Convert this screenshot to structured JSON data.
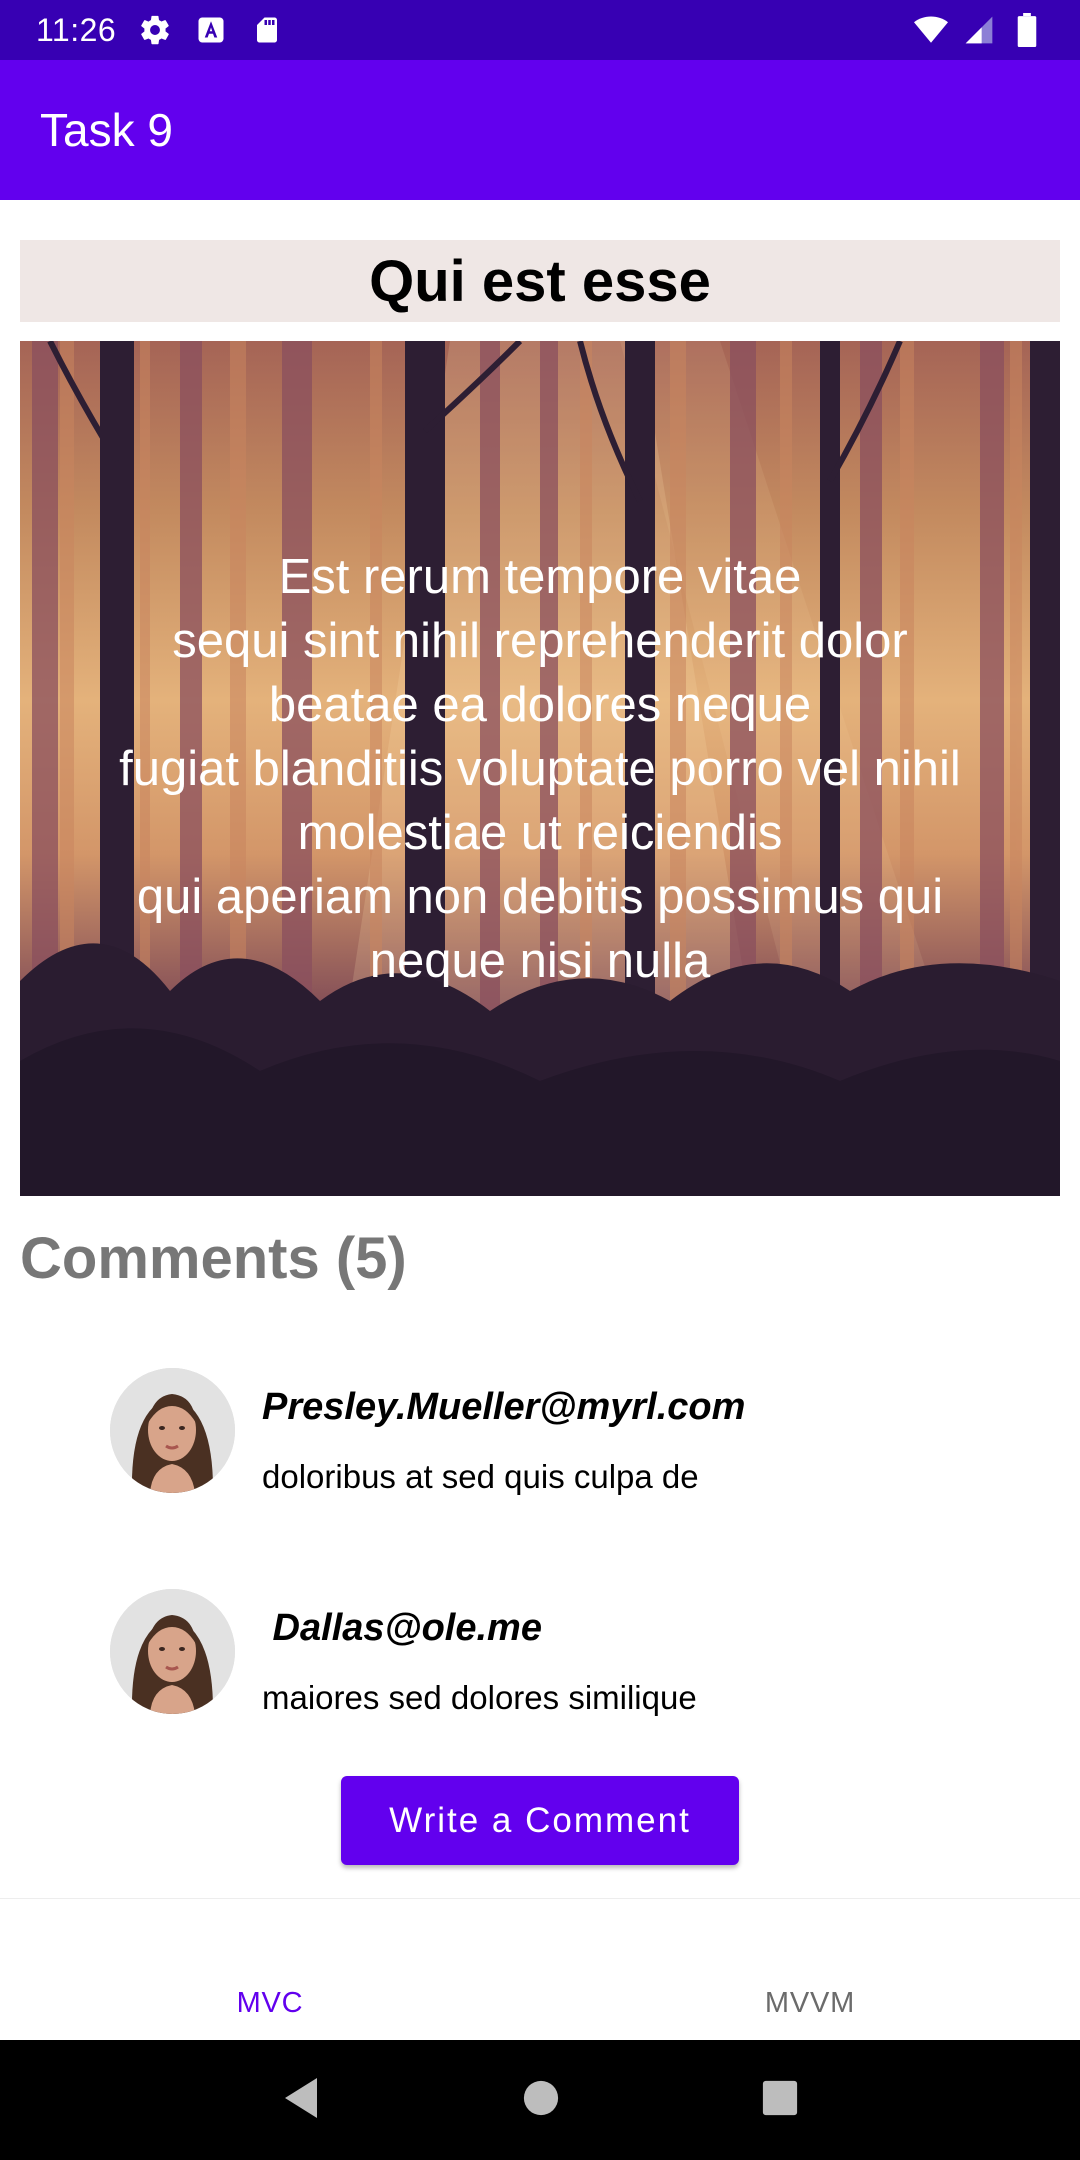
{
  "status_bar": {
    "time": "11:26",
    "left_icons": [
      "gear-icon",
      "font-a-icon",
      "sd-card-icon"
    ],
    "right_icons": [
      "wifi-icon",
      "signal-icon",
      "battery-icon"
    ]
  },
  "app_bar": {
    "title": "Task 9"
  },
  "post": {
    "title": "Qui est esse",
    "body": "Est rerum tempore vitae\nsequi sint nihil reprehenderit dolor\nbeatae ea dolores neque\nfugiat blanditiis voluptate porro vel nihil\nmolestiae ut reiciendis\nqui aperiam non debitis possimus qui\nneque nisi nulla"
  },
  "comments": {
    "heading": "Comments (5)",
    "items": [
      {
        "email": "Presley.Mueller@myrl.com",
        "body": "doloribus at sed quis culpa de"
      },
      {
        "email": " Dallas@ole.me",
        "body": "maiores sed dolores similique"
      }
    ]
  },
  "actions": {
    "write_comment": "Write a Comment"
  },
  "bottom_nav": {
    "items": [
      {
        "label": "MVC",
        "active": true
      },
      {
        "label": "MVVM",
        "active": false
      }
    ]
  },
  "colors": {
    "status_bar": "#3700b3",
    "primary": "#6200ee",
    "title_bg": "#efe7e5",
    "comment_heading": "#777777"
  }
}
